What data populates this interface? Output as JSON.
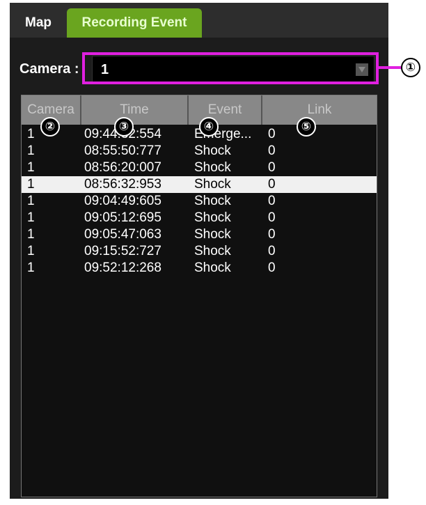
{
  "tabs": [
    {
      "label": "Map",
      "active": false
    },
    {
      "label": "Recording Event",
      "active": true
    }
  ],
  "camera_filter": {
    "label": "Camera :",
    "value": "1"
  },
  "table": {
    "headers": [
      "Camera",
      "Time",
      "Event",
      "Link"
    ],
    "rows": [
      {
        "camera": "1",
        "time": "09:44:32:554",
        "event": "Emerge...",
        "link": "0"
      },
      {
        "camera": "1",
        "time": "08:55:50:777",
        "event": "Shock",
        "link": "0"
      },
      {
        "camera": "1",
        "time": "08:56:20:007",
        "event": "Shock",
        "link": "0"
      },
      {
        "camera": "1",
        "time": "08:56:32:953",
        "event": "Shock",
        "link": "0",
        "selected": true
      },
      {
        "camera": "1",
        "time": "09:04:49:605",
        "event": "Shock",
        "link": "0"
      },
      {
        "camera": "1",
        "time": "09:05:12:695",
        "event": "Shock",
        "link": "0"
      },
      {
        "camera": "1",
        "time": "09:05:47:063",
        "event": "Shock",
        "link": "0"
      },
      {
        "camera": "1",
        "time": "09:15:52:727",
        "event": "Shock",
        "link": "0"
      },
      {
        "camera": "1",
        "time": "09:52:12:268",
        "event": "Shock",
        "link": "0"
      }
    ]
  },
  "callouts": [
    "①",
    "②",
    "③",
    "④",
    "⑤"
  ],
  "colors": {
    "accent_tab": "#6aa51f",
    "callout": "#e020e0"
  }
}
